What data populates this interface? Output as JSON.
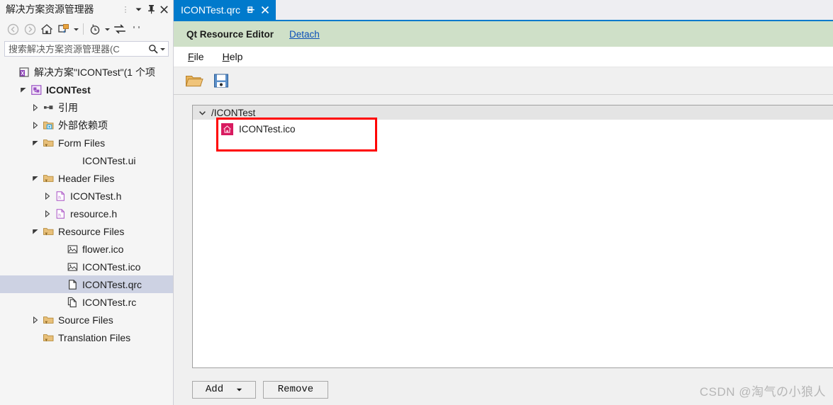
{
  "solution_explorer": {
    "title": "解决方案资源管理器",
    "header_icons": [
      {
        "name": "overflow-dots-icon",
        "glyph": "⋮"
      },
      {
        "name": "chevron-down-icon",
        "glyph": "▼"
      },
      {
        "name": "pin-icon",
        "glyph": "pin"
      },
      {
        "name": "close-icon",
        "glyph": "✕"
      }
    ],
    "toolbar": [
      {
        "name": "back-icon",
        "label": "Back"
      },
      {
        "name": "forward-icon",
        "label": "Forward"
      },
      {
        "name": "home-icon",
        "label": "Home"
      },
      {
        "name": "sync-with-active-document-icon",
        "label": "Sync"
      },
      {
        "name": "show-all-files-icon",
        "label": "Show All Files"
      },
      {
        "name": "refresh-icon",
        "label": "Refresh"
      },
      {
        "name": "collapse-all-icon",
        "label": "Collapse All"
      }
    ],
    "search": {
      "placeholder": "搜索解决方案资源管理器(C",
      "value": ""
    },
    "tree": [
      {
        "label": "解决方案\"ICONTest\"(1 个项",
        "indent": 0,
        "arrow": "none",
        "icon": "solution-icon",
        "bold": false,
        "selected": false
      },
      {
        "label": "ICONTest",
        "indent": 1,
        "arrow": "expanded",
        "icon": "project-icon",
        "bold": true,
        "selected": false
      },
      {
        "label": "引用",
        "indent": 2,
        "arrow": "collapsed",
        "icon": "references-icon",
        "bold": false,
        "selected": false
      },
      {
        "label": "外部依赖项",
        "indent": 2,
        "arrow": "collapsed",
        "icon": "external-deps-icon",
        "bold": false,
        "selected": false
      },
      {
        "label": "Form Files",
        "indent": 2,
        "arrow": "expanded",
        "icon": "filter-folder-icon",
        "bold": false,
        "selected": false
      },
      {
        "label": "ICONTest.ui",
        "indent": 4,
        "arrow": "none",
        "icon": "none",
        "bold": false,
        "selected": false
      },
      {
        "label": "Header Files",
        "indent": 2,
        "arrow": "expanded",
        "icon": "filter-folder-icon",
        "bold": false,
        "selected": false
      },
      {
        "label": "ICONTest.h",
        "indent": 3,
        "arrow": "collapsed",
        "icon": "header-file-icon",
        "bold": false,
        "selected": false
      },
      {
        "label": "resource.h",
        "indent": 3,
        "arrow": "collapsed",
        "icon": "header-file-icon",
        "bold": false,
        "selected": false
      },
      {
        "label": "Resource Files",
        "indent": 2,
        "arrow": "expanded",
        "icon": "filter-folder-icon",
        "bold": false,
        "selected": false
      },
      {
        "label": "flower.ico",
        "indent": 4,
        "arrow": "none",
        "icon": "image-file-icon",
        "bold": false,
        "selected": false
      },
      {
        "label": "ICONTest.ico",
        "indent": 4,
        "arrow": "none",
        "icon": "image-file-icon",
        "bold": false,
        "selected": false
      },
      {
        "label": "ICONTest.qrc",
        "indent": 4,
        "arrow": "none",
        "icon": "generic-file-icon",
        "bold": false,
        "selected": true
      },
      {
        "label": "ICONTest.rc",
        "indent": 4,
        "arrow": "none",
        "icon": "rc-file-icon",
        "bold": false,
        "selected": false
      },
      {
        "label": "Source Files",
        "indent": 2,
        "arrow": "collapsed",
        "icon": "filter-folder-icon",
        "bold": false,
        "selected": false
      },
      {
        "label": "Translation Files",
        "indent": 2,
        "arrow": "none",
        "icon": "filter-folder-icon",
        "bold": false,
        "selected": false
      }
    ]
  },
  "editor": {
    "tab": {
      "label": "ICONTest.qrc",
      "pin_glyph": "pin",
      "close_glyph": "✕"
    },
    "banner": {
      "title": "Qt Resource Editor",
      "detach_label": "Detach"
    },
    "menubar": [
      {
        "name": "menu-file",
        "accel": "F",
        "rest": "ile"
      },
      {
        "name": "menu-help",
        "accel": "H",
        "rest": "elp"
      }
    ],
    "toolbar": [
      {
        "name": "open-folder-icon",
        "label": "Open"
      },
      {
        "name": "save-icon",
        "label": "Save"
      }
    ],
    "resource_tree": {
      "group": {
        "label": "/ICONTest",
        "chevron": "⌄",
        "expanded": true
      },
      "items": [
        {
          "label": "ICONTest.ico",
          "icon": "ico-file-icon",
          "highlighted": true
        }
      ]
    },
    "footer": {
      "add_label": "Add",
      "add_caret": "▼",
      "remove_label": "Remove"
    }
  },
  "watermark": "CSDN @淘气の小狼人",
  "colors": {
    "tab_active": "#007acc",
    "banner_bg": "#cfe0c8",
    "highlight_border": "#ff0000",
    "tree_selection": "#cdd2e3",
    "ico_badge": "#d81b60",
    "link": "#0b4fb8"
  }
}
